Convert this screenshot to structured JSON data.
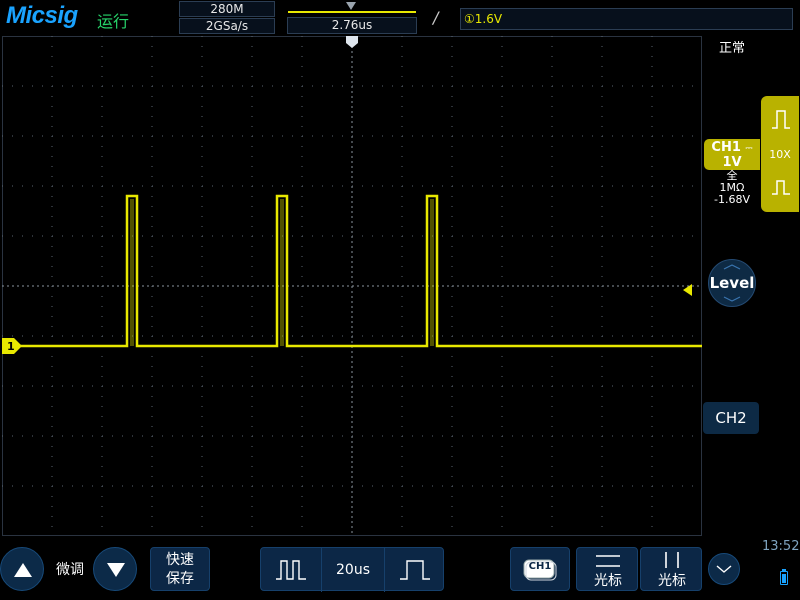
{
  "header": {
    "brand": "Micsig",
    "run_status": "运行",
    "memory_depth": "280M",
    "sample_rate": "2GSa/s",
    "horizontal_position": "2.76us",
    "trigger_edge_symbol": "/",
    "trigger_level": "①1.6V"
  },
  "right_panel": {
    "acquisition_mode": "正常",
    "ch1": {
      "name": "CH1",
      "coupling_symbol": "⎓",
      "scale": "1V",
      "bandwidth": "全",
      "impedance": "1MΩ",
      "offset": "-1.68V"
    },
    "probe_attenuation": "10X",
    "level_button": "Level",
    "ch2_button": "CH2"
  },
  "bottom_bar": {
    "fine_adjust_label": "微调",
    "fast_save_line1": "快速",
    "fast_save_line2": "保存",
    "timebase": "20us",
    "ch1_select_label": "CH1",
    "cursor_h_label": "光标",
    "cursor_v_label": "光标",
    "clock": "13:52"
  },
  "waveform": {
    "channel_marker": "1",
    "trace_color": "#e8e800",
    "low_level_div": -1.2,
    "high_level_div": 1.8,
    "pulse_start_div": [
      -4.5,
      -1.5,
      1.5
    ],
    "pulse_width_div": 0.2,
    "horizontal_divisions": 14,
    "vertical_divisions": 10
  },
  "colors": {
    "brand": "#1aa3ff",
    "run_status": "#27d36a",
    "channel1": "#e8e800",
    "panel_button": "#0c2a48"
  }
}
